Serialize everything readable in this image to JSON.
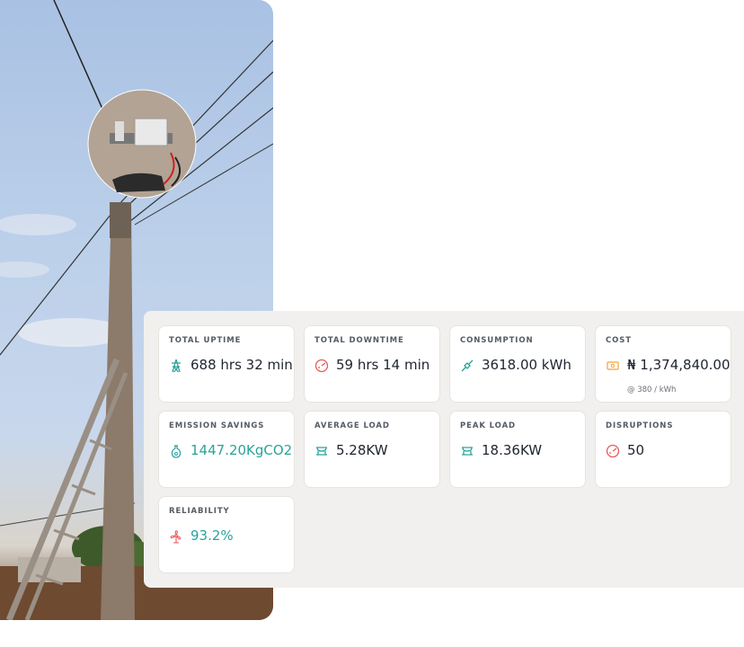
{
  "metrics": {
    "total_uptime": {
      "label": "TOTAL UPTIME",
      "value": "688 hrs 32 min"
    },
    "total_downtime": {
      "label": "TOTAL DOWNTIME",
      "value": "59 hrs 14 min"
    },
    "consumption": {
      "label": "CONSUMPTION",
      "value": "3618.00 kWh"
    },
    "cost": {
      "label": "COST",
      "value": "₦ 1,374,840.00",
      "sub": "@ 380 / kWh"
    },
    "emission": {
      "label": "EMISSION SAVINGS",
      "value": "1447.20KgCO2"
    },
    "avg_load": {
      "label": "AVERAGE LOAD",
      "value": "5.28KW"
    },
    "peak_load": {
      "label": "PEAK LOAD",
      "value": "18.36KW"
    },
    "disruptions": {
      "label": "DISRUPTIONS",
      "value": "50"
    },
    "reliability": {
      "label": "RELIABILITY",
      "value": "93.2%"
    }
  },
  "icons": {
    "total_uptime": "transmission-tower-icon",
    "total_downtime": "outage-gauge-icon",
    "consumption": "plug-icon",
    "cost": "money-icon",
    "emission": "eco-bag-icon",
    "avg_load": "load-icon",
    "peak_load": "load-icon",
    "disruptions": "outage-gauge-icon",
    "reliability": "fan-icon"
  },
  "colors": {
    "teal": "#2aa39a",
    "red": "#e8585a",
    "orange": "#f2a33a",
    "panel_bg": "#f1f0ee",
    "text_dark": "#1f2430"
  }
}
